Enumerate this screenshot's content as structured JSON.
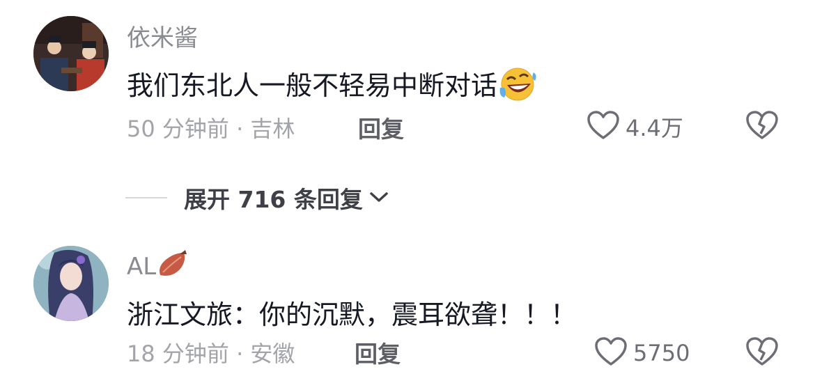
{
  "comments": [
    {
      "username": "依米酱",
      "text": "我们东北人一般不轻易中断对话",
      "time": "50 分钟前",
      "location": "吉林",
      "reply_label": "回复",
      "like_count": "4.4万",
      "avatar_icon": "avatar-photo",
      "emoji_icon": "rolling-laughing-emoji"
    },
    {
      "username": "AL",
      "username_icon": "sweet-potato-icon",
      "text": "浙江文旅：你的沉默，震耳欲聋！！！",
      "time": "18 分钟前",
      "location": "安徽",
      "reply_label": "回复",
      "like_count": "5750",
      "avatar_icon": "avatar-photo"
    }
  ],
  "expand_replies": {
    "label": "展开 716 条回复",
    "icon": "chevron-down-icon"
  },
  "separator": "·",
  "colors": {
    "text": "#161823",
    "secondary": "#8a8b91",
    "meta": "#a3a4a9",
    "emoji_yellow": "#f7c137",
    "potato": "#c65a44"
  }
}
